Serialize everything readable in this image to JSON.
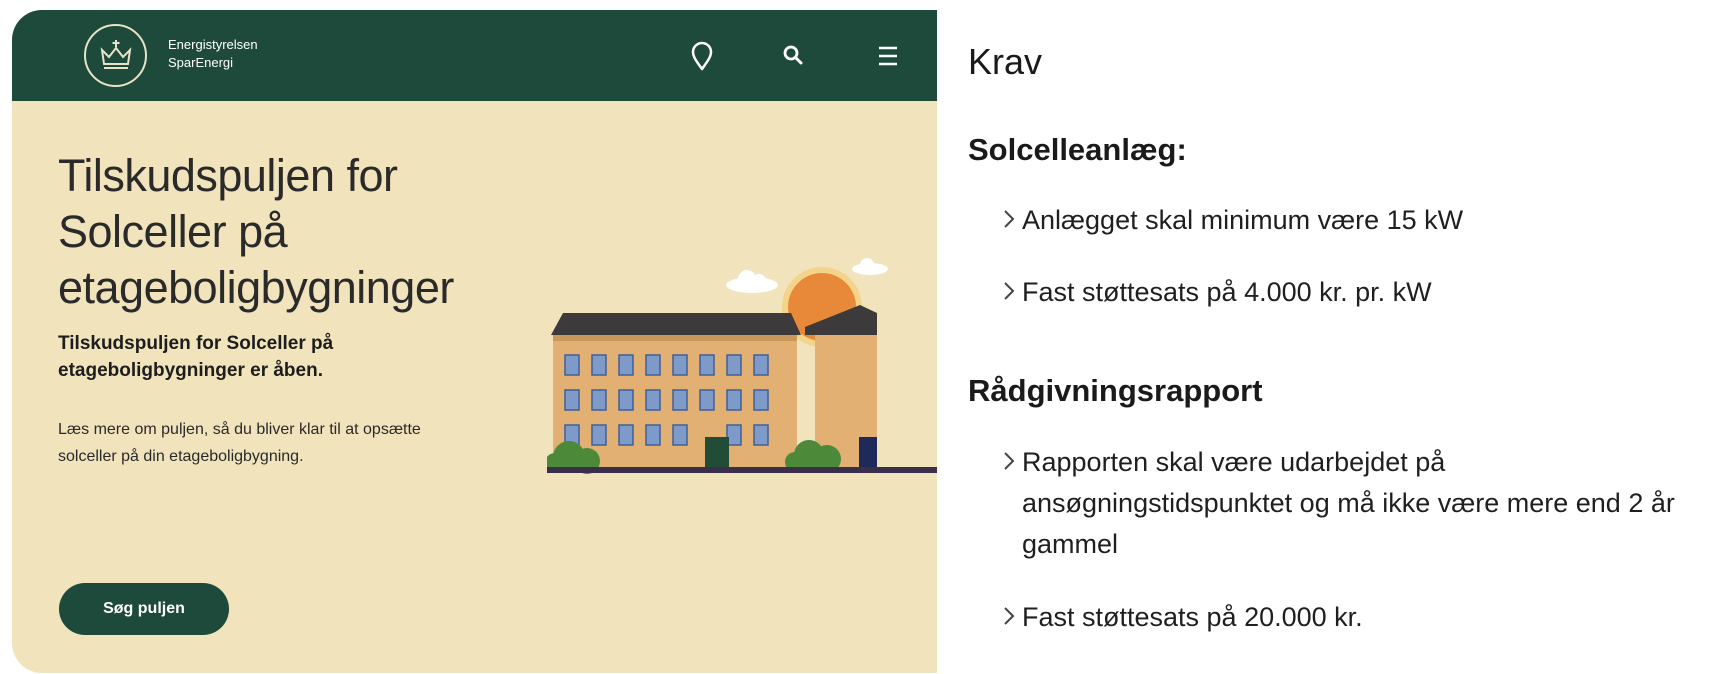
{
  "site": {
    "brand_line1": "Energistyrelsen",
    "brand_line2": "SparEnergi",
    "icons": [
      "crown-logo-icon",
      "location-pin-icon",
      "search-icon",
      "menu-icon"
    ],
    "title_line1": "Tilskudspuljen for",
    "title_line2": "Solceller på",
    "title_line3": "etageboligbygninger",
    "lead": "Tilskudspuljen for Solceller på etageboligbygninger er åben.",
    "body": "Læs mere om puljen, så du bliver klar til at opsætte solceller på din etageboligbygning.",
    "cta": "Søg puljen",
    "colors": {
      "header": "#1e4a3c",
      "background": "#f1e3bc",
      "button": "#1e4a3c"
    }
  },
  "requirements": {
    "heading": "Krav",
    "sections": [
      {
        "title": "Solcelleanlæg:",
        "items": [
          "Anlægget skal minimum være 15 kW",
          "Fast støttesats på 4.000 kr. pr. kW"
        ]
      },
      {
        "title": "Rådgivningsrapport",
        "items": [
          "Rapporten skal være udarbejdet på ansøgningstidspunktet og må ikke være mere end 2 år gammel",
          "Fast støttesats på 20.000 kr."
        ]
      }
    ]
  }
}
